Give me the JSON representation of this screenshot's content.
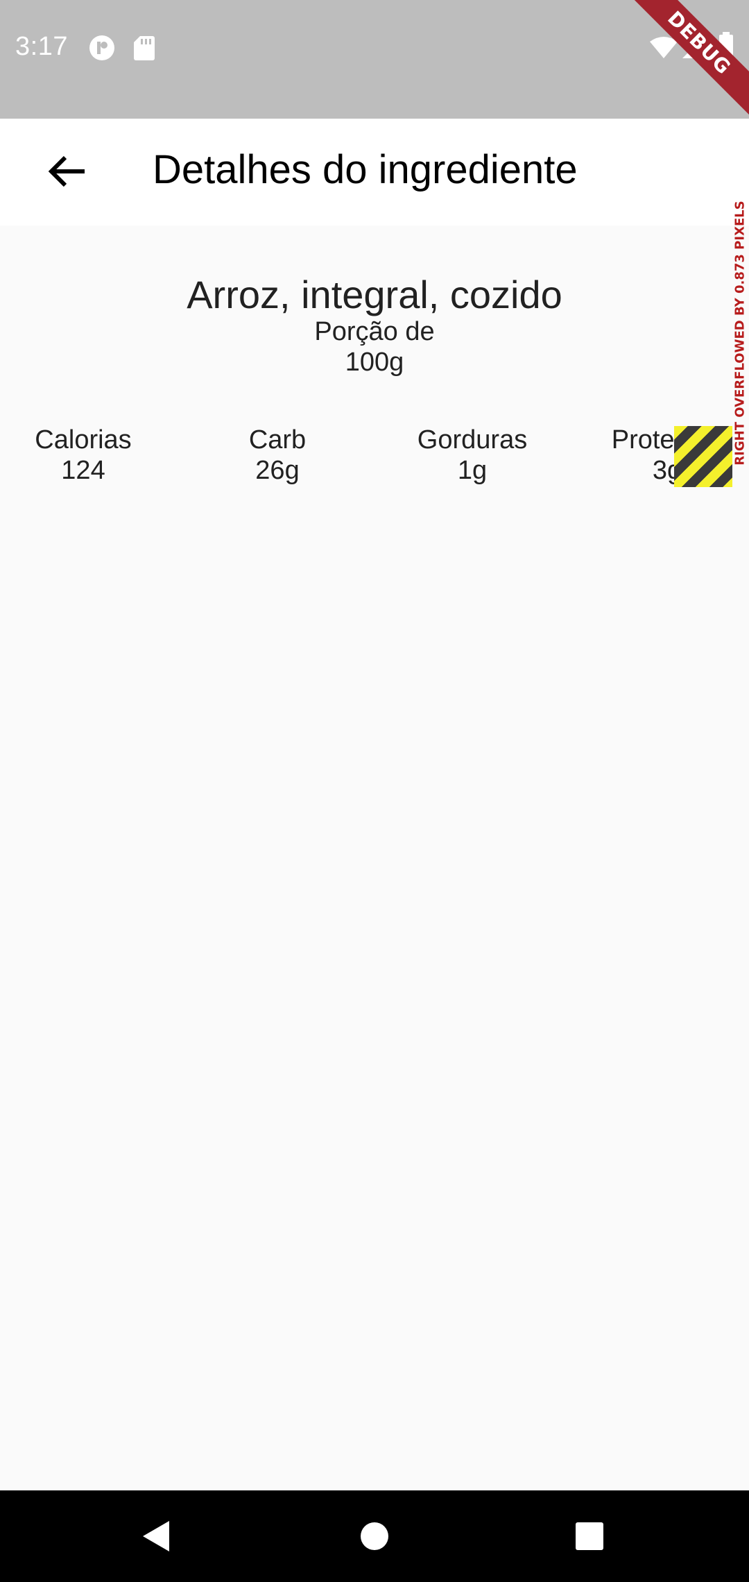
{
  "status_bar": {
    "time": "3:17",
    "icons_left": [
      "cast-icon",
      "sd-card-icon"
    ],
    "icons_right": [
      "wifi-icon",
      "signal-icon",
      "battery-icon"
    ],
    "debug_label": "DEBUG"
  },
  "app_bar": {
    "title": "Detalhes do ingrediente",
    "back_icon": "arrow-back-icon"
  },
  "ingredient": {
    "name": "Arroz, integral, cozido",
    "portion_label": "Porção de",
    "portion_value": "100g"
  },
  "nutrients": [
    {
      "label": "Calorias",
      "value": "124"
    },
    {
      "label": "Carb",
      "value": "26g"
    },
    {
      "label": "Gorduras",
      "value": "1g"
    },
    {
      "label": "Proteinas",
      "value": "3g"
    }
  ],
  "overflow_warning": "RIGHT OVERFLOWED BY 0.873 PIXELS",
  "nav_bar": {
    "buttons": [
      "back-triangle-icon",
      "home-circle-icon",
      "recents-square-icon"
    ]
  },
  "colors": {
    "status_bar": "#bdbdbd",
    "app_bar": "#ffffff",
    "background": "#fafafa",
    "debug_banner": "#a3242e",
    "overflow_text": "#b71c1c",
    "nav_bar": "#000000"
  }
}
